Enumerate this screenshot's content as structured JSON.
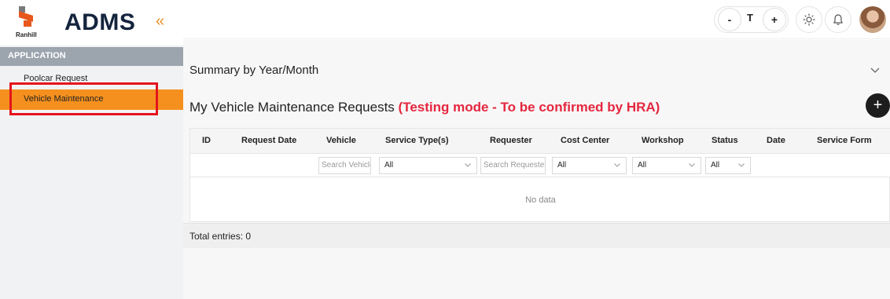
{
  "sidebar": {
    "logo_small_text": "Ranhill",
    "title": "ADMS",
    "collapse_icon": "«",
    "section": "APPLICATION",
    "items": [
      {
        "label": "Poolcar Request"
      },
      {
        "label": "Vehicle Maintenance"
      }
    ],
    "colors": {
      "active": "#f5901e",
      "highlight": "#e5141d",
      "accent": "#e8581c"
    }
  },
  "topbar": {
    "minus": "-",
    "font_label": "T",
    "plus": "+"
  },
  "main": {
    "summary_title": "Summary by Year/Month",
    "requests_title": "My Vehicle Maintenance Requests",
    "testing_note": "(Testing mode - To be confirmed by HRA)",
    "add_icon": "+",
    "columns": [
      "ID",
      "Request Date",
      "Vehicle",
      "Service Type(s)",
      "Requester",
      "Cost Center",
      "Workshop",
      "Status",
      "Date",
      "Service Form"
    ],
    "filters": {
      "vehicle_placeholder": "Search Vehicle",
      "service_type": "All",
      "requester_placeholder": "Search Requester",
      "cost_center": "All",
      "workshop": "All",
      "status": "All"
    },
    "empty_text": "No data",
    "total_entries": "Total entries: 0"
  }
}
